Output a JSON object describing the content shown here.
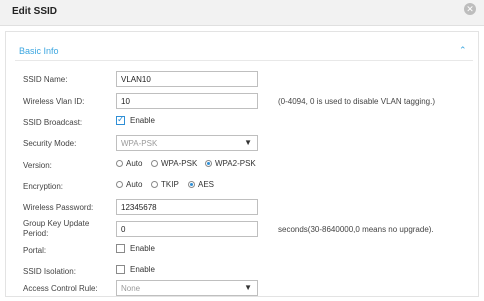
{
  "dialog": {
    "title": "Edit SSID",
    "close_icon": "close-icon"
  },
  "section": {
    "title": "Basic Info",
    "collapse_icon": "chevron-up-icon"
  },
  "fields": {
    "ssid_name": {
      "label": "SSID Name:",
      "value": "VLAN10"
    },
    "vlan_id": {
      "label": "Wireless Vlan ID:",
      "value": "10",
      "hint": "(0-4094, 0 is used to disable VLAN tagging.)"
    },
    "ssid_broadcast": {
      "label": "SSID Broadcast:",
      "checkbox_label": "Enable",
      "checked": true
    },
    "security_mode": {
      "label": "Security Mode:",
      "value": "WPA-PSK"
    },
    "version": {
      "label": "Version:",
      "options": [
        "Auto",
        "WPA-PSK",
        "WPA2-PSK"
      ],
      "selected": "WPA2-PSK"
    },
    "encryption": {
      "label": "Encryption:",
      "options": [
        "Auto",
        "TKIP",
        "AES"
      ],
      "selected": "AES"
    },
    "wireless_password": {
      "label": "Wireless Password:",
      "value": "12345678"
    },
    "group_key_update": {
      "label": "Group Key Update Period:",
      "value": "0",
      "hint": "seconds(30-8640000,0 means no upgrade)."
    },
    "portal": {
      "label": "Portal:",
      "checkbox_label": "Enable",
      "checked": false
    },
    "ssid_isolation": {
      "label": "SSID Isolation:",
      "checkbox_label": "Enable",
      "checked": false
    },
    "access_control_rule": {
      "label": "Access Control Rule:",
      "value": "None"
    }
  },
  "colors": {
    "accent": "#3ba6e0",
    "radio_selected": "#2f8fd6"
  }
}
